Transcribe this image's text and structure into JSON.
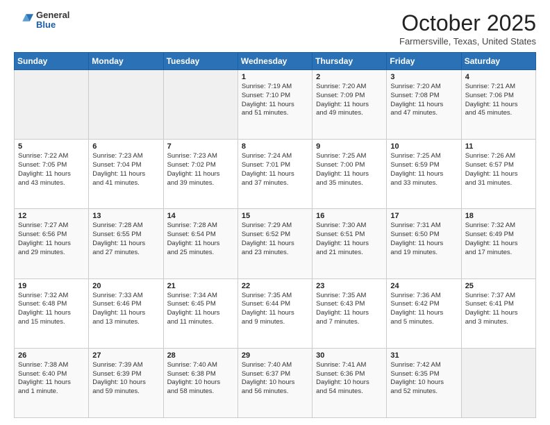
{
  "logo": {
    "general": "General",
    "blue": "Blue"
  },
  "header": {
    "month": "October 2025",
    "location": "Farmersville, Texas, United States"
  },
  "weekdays": [
    "Sunday",
    "Monday",
    "Tuesday",
    "Wednesday",
    "Thursday",
    "Friday",
    "Saturday"
  ],
  "weeks": [
    [
      {
        "day": "",
        "content": ""
      },
      {
        "day": "",
        "content": ""
      },
      {
        "day": "",
        "content": ""
      },
      {
        "day": "1",
        "content": "Sunrise: 7:19 AM\nSunset: 7:10 PM\nDaylight: 11 hours\nand 51 minutes."
      },
      {
        "day": "2",
        "content": "Sunrise: 7:20 AM\nSunset: 7:09 PM\nDaylight: 11 hours\nand 49 minutes."
      },
      {
        "day": "3",
        "content": "Sunrise: 7:20 AM\nSunset: 7:08 PM\nDaylight: 11 hours\nand 47 minutes."
      },
      {
        "day": "4",
        "content": "Sunrise: 7:21 AM\nSunset: 7:06 PM\nDaylight: 11 hours\nand 45 minutes."
      }
    ],
    [
      {
        "day": "5",
        "content": "Sunrise: 7:22 AM\nSunset: 7:05 PM\nDaylight: 11 hours\nand 43 minutes."
      },
      {
        "day": "6",
        "content": "Sunrise: 7:23 AM\nSunset: 7:04 PM\nDaylight: 11 hours\nand 41 minutes."
      },
      {
        "day": "7",
        "content": "Sunrise: 7:23 AM\nSunset: 7:02 PM\nDaylight: 11 hours\nand 39 minutes."
      },
      {
        "day": "8",
        "content": "Sunrise: 7:24 AM\nSunset: 7:01 PM\nDaylight: 11 hours\nand 37 minutes."
      },
      {
        "day": "9",
        "content": "Sunrise: 7:25 AM\nSunset: 7:00 PM\nDaylight: 11 hours\nand 35 minutes."
      },
      {
        "day": "10",
        "content": "Sunrise: 7:25 AM\nSunset: 6:59 PM\nDaylight: 11 hours\nand 33 minutes."
      },
      {
        "day": "11",
        "content": "Sunrise: 7:26 AM\nSunset: 6:57 PM\nDaylight: 11 hours\nand 31 minutes."
      }
    ],
    [
      {
        "day": "12",
        "content": "Sunrise: 7:27 AM\nSunset: 6:56 PM\nDaylight: 11 hours\nand 29 minutes."
      },
      {
        "day": "13",
        "content": "Sunrise: 7:28 AM\nSunset: 6:55 PM\nDaylight: 11 hours\nand 27 minutes."
      },
      {
        "day": "14",
        "content": "Sunrise: 7:28 AM\nSunset: 6:54 PM\nDaylight: 11 hours\nand 25 minutes."
      },
      {
        "day": "15",
        "content": "Sunrise: 7:29 AM\nSunset: 6:52 PM\nDaylight: 11 hours\nand 23 minutes."
      },
      {
        "day": "16",
        "content": "Sunrise: 7:30 AM\nSunset: 6:51 PM\nDaylight: 11 hours\nand 21 minutes."
      },
      {
        "day": "17",
        "content": "Sunrise: 7:31 AM\nSunset: 6:50 PM\nDaylight: 11 hours\nand 19 minutes."
      },
      {
        "day": "18",
        "content": "Sunrise: 7:32 AM\nSunset: 6:49 PM\nDaylight: 11 hours\nand 17 minutes."
      }
    ],
    [
      {
        "day": "19",
        "content": "Sunrise: 7:32 AM\nSunset: 6:48 PM\nDaylight: 11 hours\nand 15 minutes."
      },
      {
        "day": "20",
        "content": "Sunrise: 7:33 AM\nSunset: 6:46 PM\nDaylight: 11 hours\nand 13 minutes."
      },
      {
        "day": "21",
        "content": "Sunrise: 7:34 AM\nSunset: 6:45 PM\nDaylight: 11 hours\nand 11 minutes."
      },
      {
        "day": "22",
        "content": "Sunrise: 7:35 AM\nSunset: 6:44 PM\nDaylight: 11 hours\nand 9 minutes."
      },
      {
        "day": "23",
        "content": "Sunrise: 7:35 AM\nSunset: 6:43 PM\nDaylight: 11 hours\nand 7 minutes."
      },
      {
        "day": "24",
        "content": "Sunrise: 7:36 AM\nSunset: 6:42 PM\nDaylight: 11 hours\nand 5 minutes."
      },
      {
        "day": "25",
        "content": "Sunrise: 7:37 AM\nSunset: 6:41 PM\nDaylight: 11 hours\nand 3 minutes."
      }
    ],
    [
      {
        "day": "26",
        "content": "Sunrise: 7:38 AM\nSunset: 6:40 PM\nDaylight: 11 hours\nand 1 minute."
      },
      {
        "day": "27",
        "content": "Sunrise: 7:39 AM\nSunset: 6:39 PM\nDaylight: 10 hours\nand 59 minutes."
      },
      {
        "day": "28",
        "content": "Sunrise: 7:40 AM\nSunset: 6:38 PM\nDaylight: 10 hours\nand 58 minutes."
      },
      {
        "day": "29",
        "content": "Sunrise: 7:40 AM\nSunset: 6:37 PM\nDaylight: 10 hours\nand 56 minutes."
      },
      {
        "day": "30",
        "content": "Sunrise: 7:41 AM\nSunset: 6:36 PM\nDaylight: 10 hours\nand 54 minutes."
      },
      {
        "day": "31",
        "content": "Sunrise: 7:42 AM\nSunset: 6:35 PM\nDaylight: 10 hours\nand 52 minutes."
      },
      {
        "day": "",
        "content": ""
      }
    ]
  ]
}
